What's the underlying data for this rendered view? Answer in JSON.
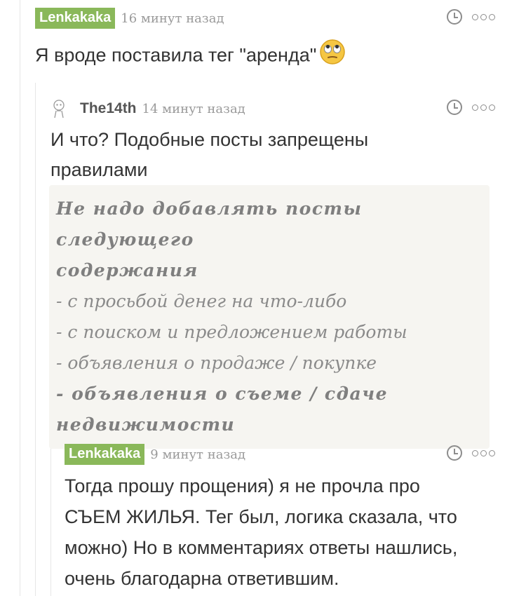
{
  "comments": [
    {
      "username": "Lenkakaka",
      "time": "16 минут назад",
      "text": "Я вроде поставила тег \"аренда\""
    },
    {
      "username": "The14th",
      "time": "14 минут назад",
      "text_line1": "И что? Подобные посты запрещены",
      "text_line2": "правилами",
      "quote": {
        "line1": "Не надо добавлять посты следующего",
        "line2": "содержания",
        "line3": "- с просьбой денег на что-либо",
        "line4": "- с поиском и предложением работы",
        "line5": "- объявления о продаже / покупке",
        "line6": "- объявления о съеме / сдаче",
        "line7": "недвижимости"
      }
    },
    {
      "username": "Lenkakaka",
      "time": "9 минут назад",
      "line1": "Тогда прошу прощения) я не прочла про",
      "line2": "СЪЕМ ЖИЛЬЯ. Тег был, логика сказала, что",
      "line3": "можно) Но в комментариях ответы нашлись,",
      "line4": "очень благодарна ответившим."
    }
  ],
  "icons": {
    "emoji": "eye-roll-emoji",
    "time_icon": "clock-icon",
    "more_icon": "more-options-icon",
    "avatar": "default-avatar-icon"
  },
  "colors": {
    "badge": "#8ab85a",
    "quote_bg": "#f6f5f1"
  }
}
